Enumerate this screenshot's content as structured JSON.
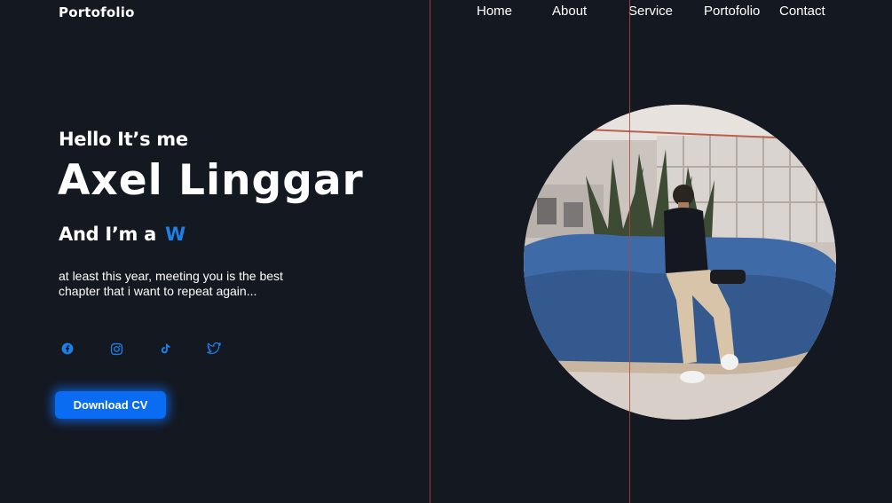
{
  "logo": "Portofolio",
  "nav": [
    {
      "label": "Home"
    },
    {
      "label": "About"
    },
    {
      "label": "Service"
    },
    {
      "label": "Portofolio"
    },
    {
      "label": "Contact"
    }
  ],
  "hero": {
    "greeting": "Hello It’s me",
    "name": "Axel Linggar",
    "role_prefix": "And I’m  a",
    "role_typed": "W",
    "description": "at least this year, meeting you is the best chapter that i want to repeat again..."
  },
  "social": [
    {
      "icon": "facebook-icon"
    },
    {
      "icon": "instagram-icon"
    },
    {
      "icon": "tiktok-icon"
    },
    {
      "icon": "twitter-icon"
    }
  ],
  "cta": {
    "label": "Download CV"
  },
  "colors": {
    "background": "#141820",
    "accent": "#1d7fe8",
    "button": "#0a6cf2",
    "guide_line": "#b3453a"
  }
}
